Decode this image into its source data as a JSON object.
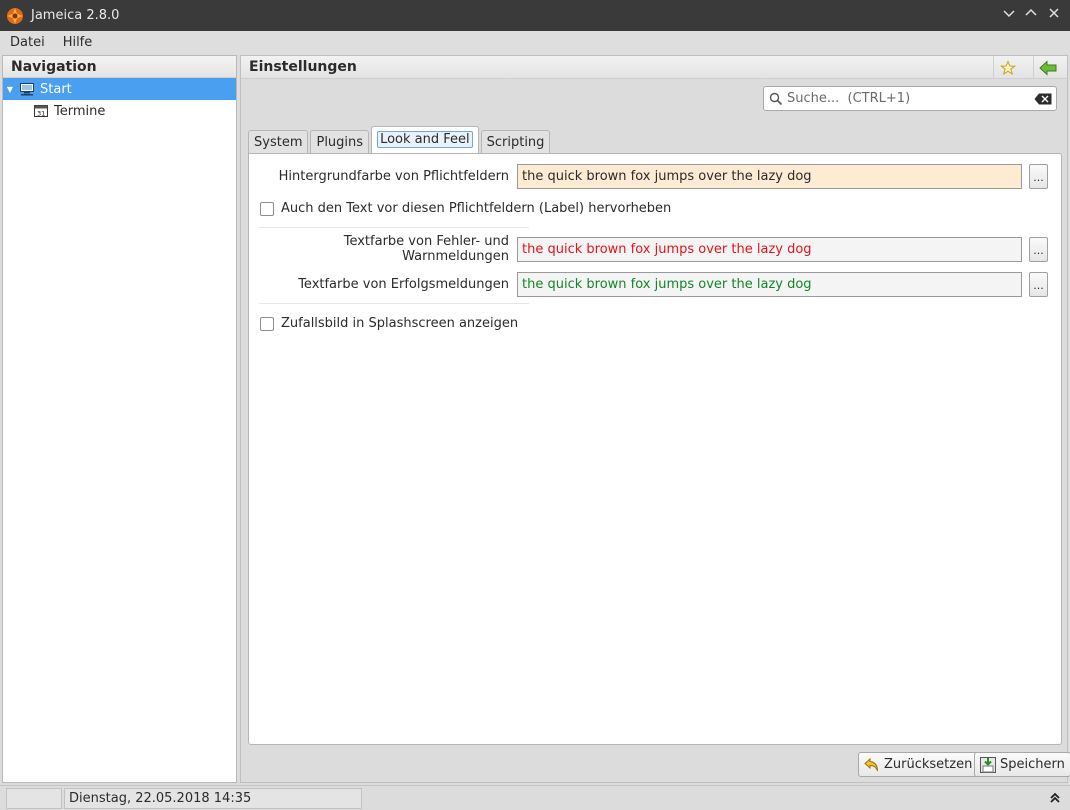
{
  "window": {
    "title": "Jameica 2.8.0",
    "minimize_icon": "chevron-down-icon",
    "maximize_icon": "chevron-up-icon",
    "close_icon": "close-icon"
  },
  "menu": {
    "items": [
      "Datei",
      "Hilfe"
    ]
  },
  "navigation": {
    "header": "Navigation",
    "items": [
      {
        "label": "Start",
        "icon": "computer-icon",
        "selected": true,
        "expanded": true
      },
      {
        "label": "Termine",
        "icon": "calendar-icon",
        "selected": false
      }
    ]
  },
  "main": {
    "title": "Einstellungen",
    "search_placeholder": "Suche...  (CTRL+1)",
    "tabs": [
      {
        "label": "System",
        "active": false
      },
      {
        "label": "Plugins",
        "active": false
      },
      {
        "label": "Look and Feel",
        "active": true
      },
      {
        "label": "Scripting",
        "active": false
      }
    ],
    "look_and_feel": {
      "required_bg_label": "Hintergrundfarbe von Pflichtfeldern",
      "required_bg_value": "the quick brown fox jumps over the lazy dog",
      "required_bg_color": "#fdebd3",
      "highlight_label_text": "Auch den Text vor diesen Pflichtfeldern (Label) hervorheben",
      "highlight_label_checked": false,
      "error_color_label": "Textfarbe von Fehler- und Warnmeldungen",
      "error_color_value": "the quick brown fox jumps over the lazy dog",
      "error_color": "#e0161b",
      "success_color_label": "Textfarbe von Erfolgsmeldungen",
      "success_color_value": "the quick brown fox jumps over the lazy dog",
      "success_color": "#14862a",
      "splash_text": "Zufallsbild in Splashscreen anzeigen",
      "splash_checked": false,
      "picker_label": "..."
    },
    "buttons": {
      "reset": "Zurücksetzen",
      "save": "Speichern"
    }
  },
  "statusbar": {
    "datetime": "Dienstag, 22.05.2018 14:35"
  },
  "colors": {
    "selection": "#4a9ff0",
    "titlebar": "#3a3a3a"
  }
}
